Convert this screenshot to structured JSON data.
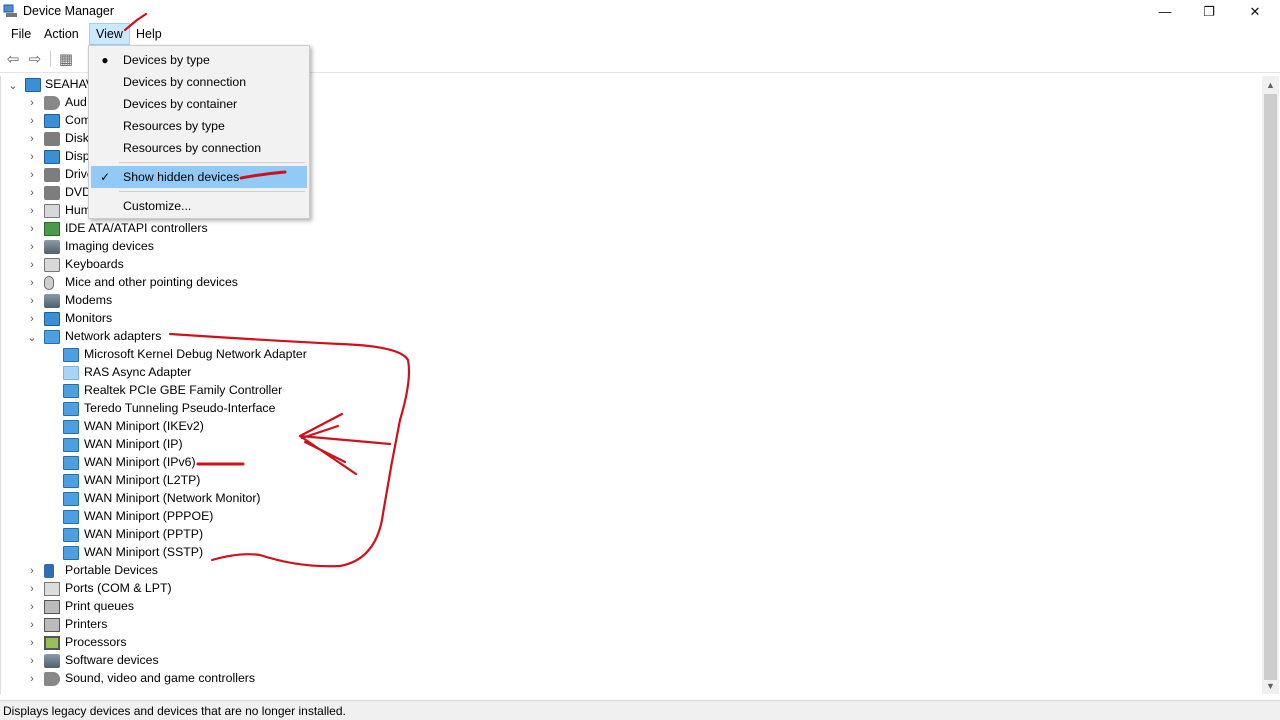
{
  "window": {
    "title": "Device Manager",
    "minimize": "—",
    "maximize": "❐",
    "close": "✕"
  },
  "menubar": {
    "file": "File",
    "action": "Action",
    "view": "View",
    "help": "Help"
  },
  "toolbar": {
    "back_icon": "⇦",
    "forward_icon": "⇨",
    "properties_icon": "▦"
  },
  "tree": {
    "root": "SEAHAV",
    "categories_top": [
      {
        "label": "Aud",
        "icon": "sound-icon"
      },
      {
        "label": "Com",
        "icon": "computer-icon"
      },
      {
        "label": "Disk",
        "icon": "disk-icon"
      },
      {
        "label": "Disp",
        "icon": "display-icon"
      },
      {
        "label": "Drive",
        "icon": "driver-icon"
      },
      {
        "label": "DVD",
        "icon": "dvd-icon"
      },
      {
        "label": "Hum",
        "icon": "hid-icon"
      },
      {
        "label": "IDE ATA/ATAPI controllers",
        "icon": "ide-icon"
      },
      {
        "label": "Imaging devices",
        "icon": "camera-icon"
      },
      {
        "label": "Keyboards",
        "icon": "keyboard-icon"
      },
      {
        "label": "Mice and other pointing devices",
        "icon": "mouse-icon"
      },
      {
        "label": "Modems",
        "icon": "modem-icon"
      },
      {
        "label": "Monitors",
        "icon": "monitor-icon"
      }
    ],
    "network": {
      "label": "Network adapters",
      "children": [
        "Microsoft Kernel Debug Network Adapter",
        "RAS Async Adapter",
        "Realtek PCIe GBE Family Controller",
        "Teredo Tunneling Pseudo-Interface",
        "WAN Miniport (IKEv2)",
        "WAN Miniport (IP)",
        "WAN Miniport (IPv6)",
        "WAN Miniport (L2TP)",
        "WAN Miniport (Network Monitor)",
        "WAN Miniport (PPPOE)",
        "WAN Miniport (PPTP)",
        "WAN Miniport (SSTP)"
      ]
    },
    "categories_bottom": [
      {
        "label": "Portable Devices",
        "icon": "portable-icon"
      },
      {
        "label": "Ports (COM & LPT)",
        "icon": "port-icon"
      },
      {
        "label": "Print queues",
        "icon": "print-queue-icon"
      },
      {
        "label": "Printers",
        "icon": "printer-icon"
      },
      {
        "label": "Processors",
        "icon": "processor-icon"
      },
      {
        "label": "Software devices",
        "icon": "software-icon"
      },
      {
        "label": "Sound, video and game controllers",
        "icon": "sound-icon"
      }
    ]
  },
  "view_menu": {
    "items": [
      {
        "label": "Devices by type",
        "mark": "●"
      },
      {
        "label": "Devices by connection",
        "mark": ""
      },
      {
        "label": "Devices by container",
        "mark": ""
      },
      {
        "label": "Resources by type",
        "mark": ""
      },
      {
        "label": "Resources by connection",
        "mark": ""
      }
    ],
    "show_hidden": {
      "label": "Show hidden devices",
      "mark": "✓"
    },
    "customize": "Customize..."
  },
  "statusbar": {
    "text": "Displays legacy devices and devices that are no longer installed."
  },
  "colors": {
    "annotation": "#d0101c",
    "highlight": "#91c9f7",
    "menu_active": "#cce8ff"
  }
}
